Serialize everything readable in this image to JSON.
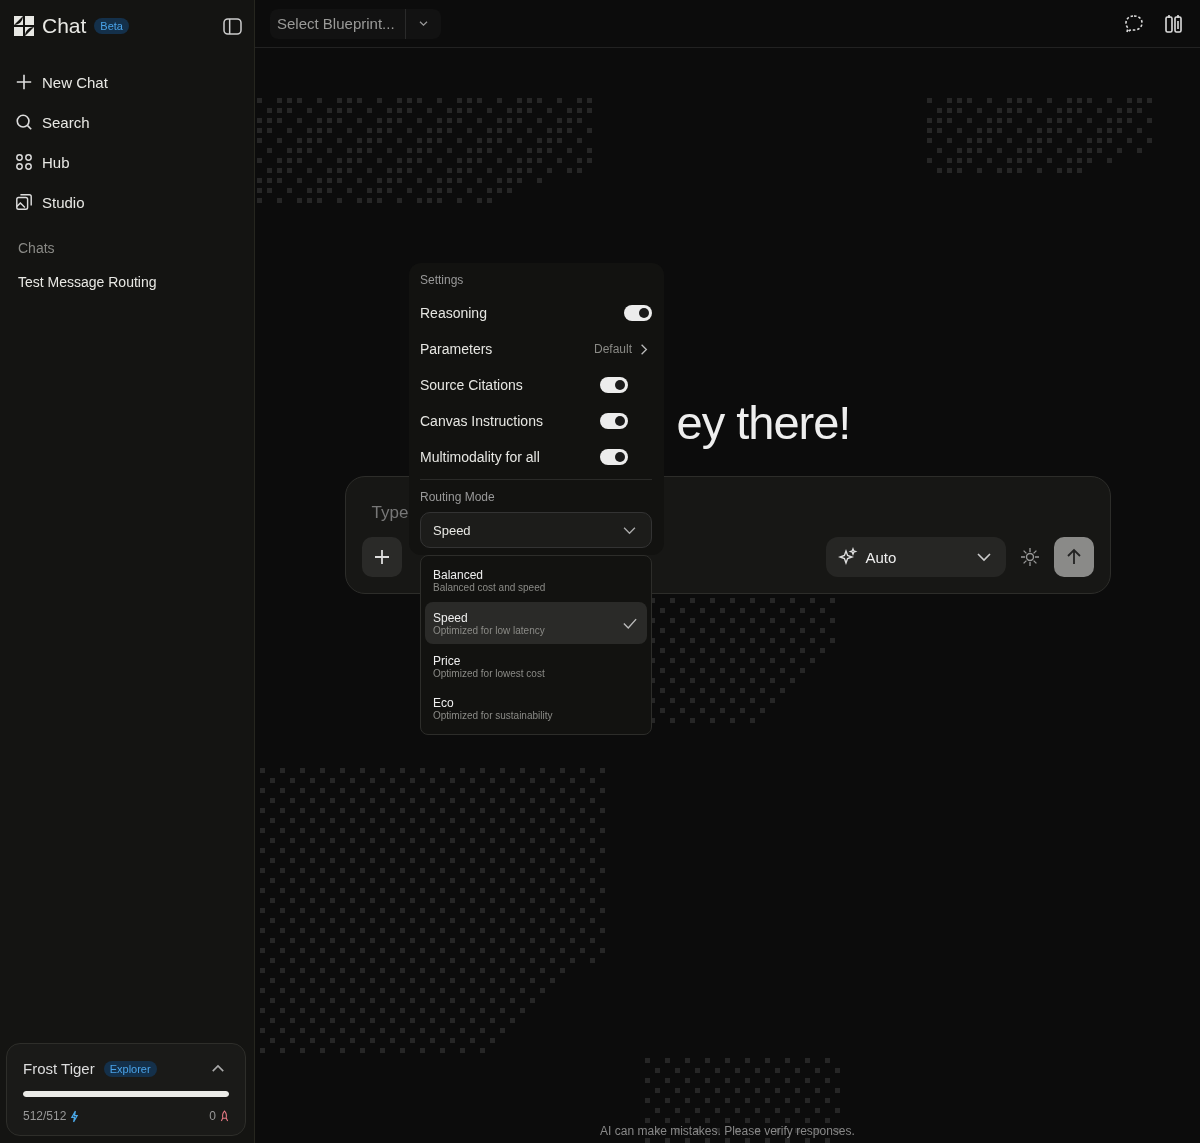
{
  "sidebar": {
    "app_title": "Chat",
    "badge": "Beta",
    "nav": [
      {
        "label": "New Chat",
        "kind": "new"
      },
      {
        "label": "Search",
        "kind": "search"
      },
      {
        "label": "Hub",
        "kind": "hub"
      },
      {
        "label": "Studio",
        "kind": "studio"
      }
    ],
    "section_label": "Chats",
    "chats": [
      {
        "label": "Test Message Routing"
      }
    ],
    "user": {
      "name": "Frost Tiger",
      "tier": "Explorer",
      "level": 1,
      "credits": "512/512",
      "boosts": "0"
    }
  },
  "topbar": {
    "blueprint_select": "Select Blueprint..."
  },
  "greeting": "ey there!",
  "composer": {
    "placeholder": "Type",
    "model": "Auto"
  },
  "settings": {
    "title": "Settings",
    "rows": [
      {
        "kind": "toggle",
        "label": "Reasoning",
        "on": true
      },
      {
        "kind": "link",
        "label": "Parameters",
        "value": "Default"
      },
      {
        "kind": "toggle",
        "label": "Source Citations",
        "on": true
      },
      {
        "kind": "toggle",
        "label": "Canvas Instructions",
        "on": true
      },
      {
        "kind": "toggle",
        "label": "Multimodality for all",
        "on": true
      }
    ],
    "routing_label": "Routing Mode",
    "routing_value": "Speed",
    "routing_options": [
      {
        "label": "Balanced",
        "description": "Balanced cost and speed",
        "selected": false
      },
      {
        "label": "Speed",
        "description": "Optimized for low latency",
        "selected": true
      },
      {
        "label": "Price",
        "description": "Optimized for lowest cost",
        "selected": false
      },
      {
        "label": "Eco",
        "description": "Optimized for sustainability",
        "selected": false
      }
    ]
  },
  "footer": "AI can make mistakes. Please verify responses."
}
